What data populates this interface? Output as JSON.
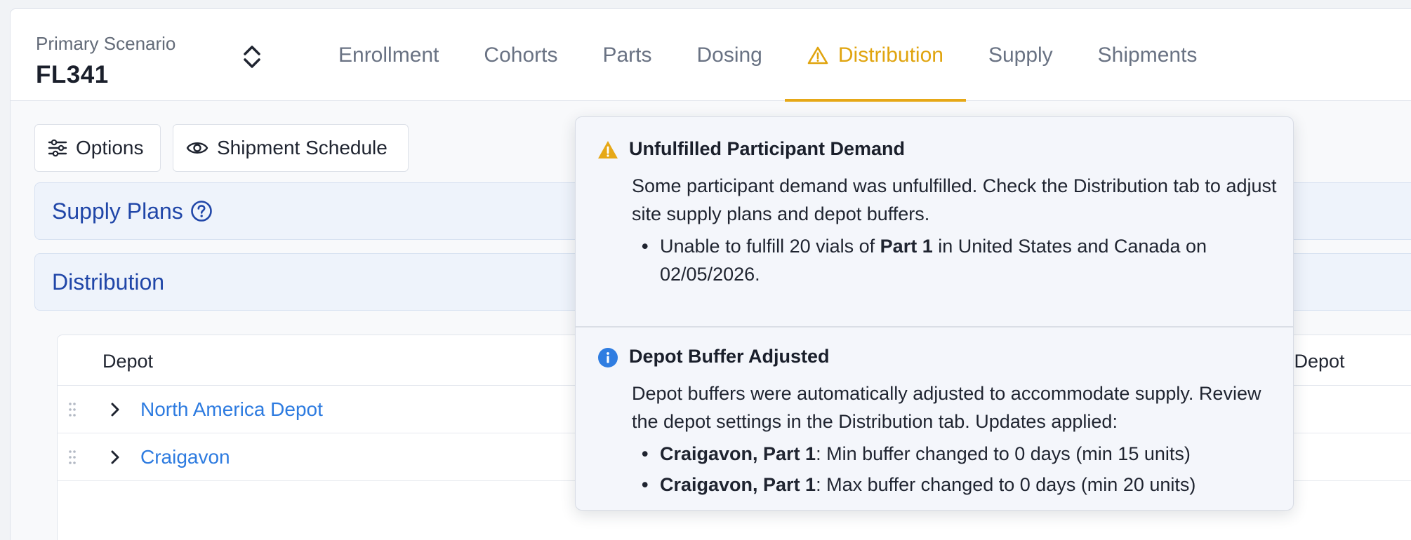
{
  "header": {
    "scenario_label": "Primary Scenario",
    "scenario_name": "FL341",
    "tabs": [
      {
        "label": "Enrollment"
      },
      {
        "label": "Cohorts"
      },
      {
        "label": "Parts"
      },
      {
        "label": "Dosing"
      },
      {
        "label": "Distribution",
        "active": true,
        "icon": "warning-icon"
      },
      {
        "label": "Supply"
      },
      {
        "label": "Shipments"
      }
    ]
  },
  "toolbar": {
    "options_label": "Options",
    "shipment_schedule_label": "Shipment Schedule"
  },
  "sections": {
    "supply_plans": "Supply Plans",
    "distribution": "Distribution"
  },
  "table": {
    "col_depot": "Depot",
    "col_right": "l Depot",
    "rows": [
      {
        "name": "North America Depot"
      },
      {
        "name": "Craigavon"
      }
    ]
  },
  "popover": {
    "warning": {
      "title": "Unfulfilled Participant Demand",
      "text": "Some participant demand was unfulfilled. Check the Distribution tab to adjust site supply plans and depot buffers.",
      "item_prefix": "Unable to fulfill 20 vials of ",
      "item_bold": "Part 1",
      "item_suffix": " in United States and Canada on 02/05/2026."
    },
    "info": {
      "title": "Depot Buffer Adjusted",
      "text": "Depot buffers were automatically adjusted to accommodate supply. Review the depot settings in the Distribution tab. Updates applied:",
      "items": [
        {
          "bold": "Craigavon, Part 1",
          "rest": ": Min buffer changed to 0 days (min 15 units)"
        },
        {
          "bold": "Craigavon, Part 1",
          "rest": ": Max buffer changed to 0 days (min 20 units)"
        }
      ]
    }
  },
  "colors": {
    "accent_warning": "#e0a40e",
    "link": "#2d7be0",
    "section_text": "#2046a8",
    "info": "#2f7de1"
  }
}
